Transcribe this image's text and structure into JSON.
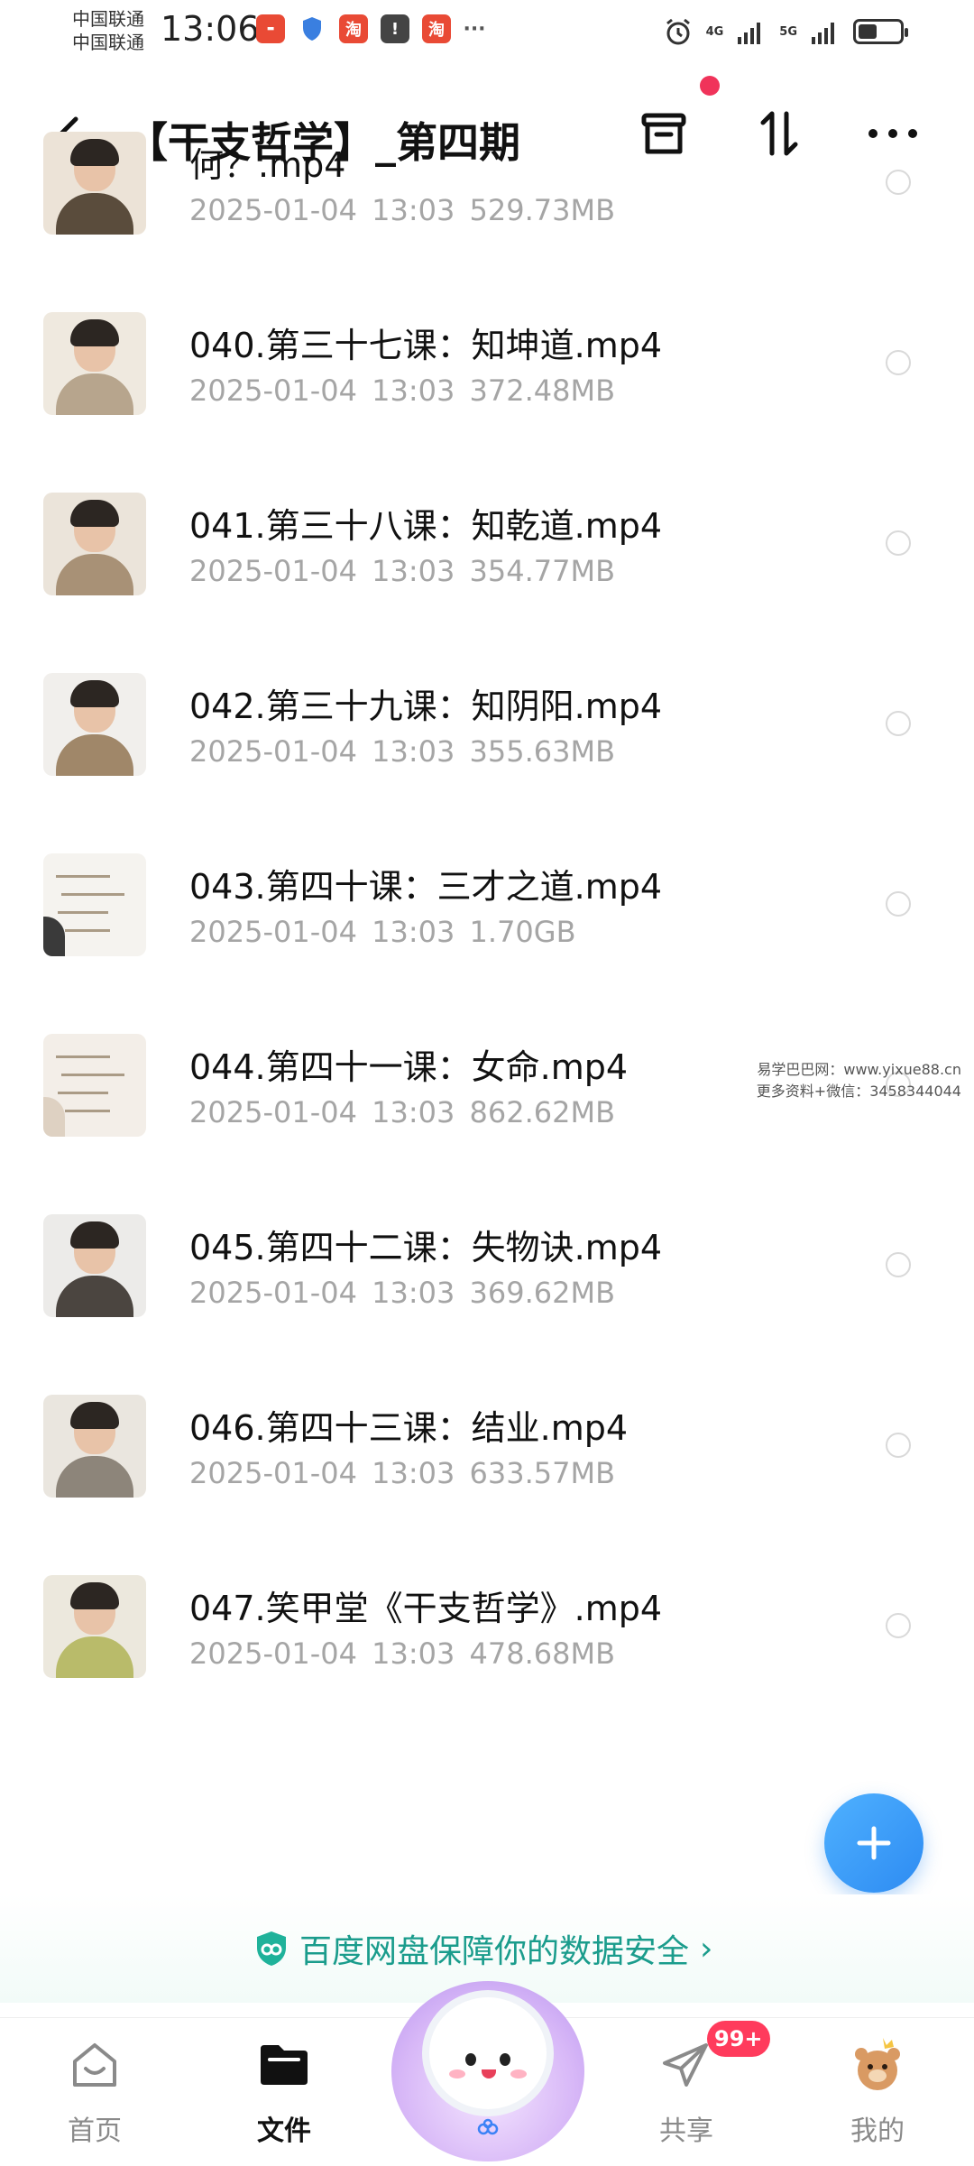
{
  "status_bar": {
    "carrier_1": "中国联通",
    "carrier_2": "中国联通",
    "time": "13:06",
    "network_1": "4G",
    "network_2": "5G",
    "notification_icons": [
      "app-notification-icon",
      "shield-icon",
      "taobao-icon",
      "alert-icon",
      "taobao-icon",
      "more-notifications-icon"
    ],
    "battery_level": 0.45
  },
  "header": {
    "title": "【干支哲学】_第四期",
    "has_notification_dot": true
  },
  "files": [
    {
      "name": "何？.mp4",
      "date": "2025-01-04",
      "time": "13:03",
      "size": "529.73MB",
      "thumb": "person",
      "body_color": "#5a4c3c",
      "bg": "#ece3d7"
    },
    {
      "name": "040.第三十七课：知坤道.mp4",
      "date": "2025-01-04",
      "time": "13:03",
      "size": "372.48MB",
      "thumb": "person",
      "body_color": "#b7a58d",
      "bg": "#efe9df"
    },
    {
      "name": "041.第三十八课：知乾道.mp4",
      "date": "2025-01-04",
      "time": "13:03",
      "size": "354.77MB",
      "thumb": "person",
      "body_color": "#a89176",
      "bg": "#ebe4da"
    },
    {
      "name": "042.第三十九课：知阴阳.mp4",
      "date": "2025-01-04",
      "time": "13:03",
      "size": "355.63MB",
      "thumb": "person",
      "body_color": "#a08769",
      "bg": "#f1efec"
    },
    {
      "name": "043.第四十课：三才之道.mp4",
      "date": "2025-01-04",
      "time": "13:03",
      "size": "1.70GB",
      "thumb": "board",
      "body_color": "#3a3a3a",
      "bg": "#f5f3ef"
    },
    {
      "name": "044.第四十一课：女命.mp4",
      "date": "2025-01-04",
      "time": "13:03",
      "size": "862.62MB",
      "thumb": "board",
      "body_color": "#ded1c2",
      "bg": "#f3eee8"
    },
    {
      "name": "045.第四十二课：失物诀.mp4",
      "date": "2025-01-04",
      "time": "13:03",
      "size": "369.62MB",
      "thumb": "person",
      "body_color": "#4b4540",
      "bg": "#ecebe9"
    },
    {
      "name": "046.第四十三课：结业.mp4",
      "date": "2025-01-04",
      "time": "13:03",
      "size": "633.57MB",
      "thumb": "person",
      "body_color": "#8d857a",
      "bg": "#eae6df"
    },
    {
      "name": "047.笑甲堂《干支哲学》.mp4",
      "date": "2025-01-04",
      "time": "13:03",
      "size": "478.68MB",
      "thumb": "person",
      "body_color": "#b9bb6a",
      "bg": "#ece8dd"
    }
  ],
  "watermark": {
    "line_1": "易学巴巴网：www.yixue88.cn",
    "line_2": "更多资料+微信：3458344044"
  },
  "security_banner": {
    "text": "百度网盘保障你的数据安全",
    "accent_color": "#1a9c8c"
  },
  "nav": {
    "home_label": "首页",
    "files_label": "文件",
    "share_label": "共享",
    "mine_label": "我的",
    "share_badge": "99+",
    "active": "files"
  },
  "colors": {
    "accent": "#2d8bf2",
    "badge": "#ff3b5c",
    "meta_text": "#a5a5a5"
  }
}
